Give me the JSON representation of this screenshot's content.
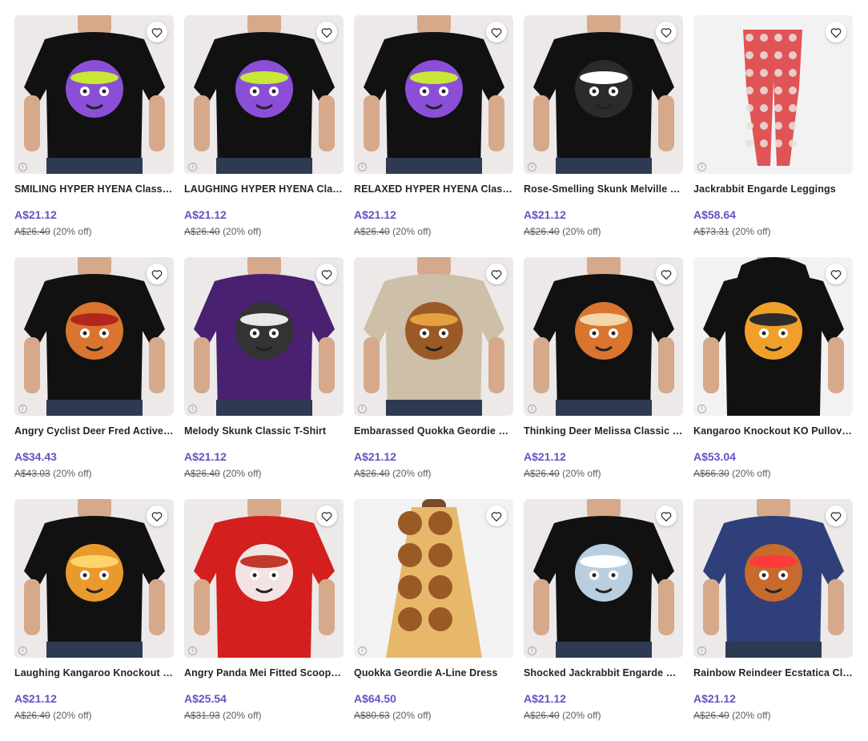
{
  "colors": {
    "price": "#6a4fc3",
    "tile_bg": "#f2f2f3"
  },
  "products": [
    {
      "title": "SMILING HYPER HYENA Classic T-Shirt",
      "price": "A$21.12",
      "original": "A$26.40",
      "discount": "(20% off)",
      "kind": "tee",
      "shirt": "#111111",
      "art": "hyena",
      "bg": "#ece9e8"
    },
    {
      "title": "LAUGHING HYPER HYENA Classic T-Shirt",
      "price": "A$21.12",
      "original": "A$26.40",
      "discount": "(20% off)",
      "kind": "tee",
      "shirt": "#111111",
      "art": "hyena2",
      "bg": "#ece9e8"
    },
    {
      "title": "RELAXED HYPER HYENA Classic T-Shirt",
      "price": "A$21.12",
      "original": "A$26.40",
      "discount": "(20% off)",
      "kind": "tee",
      "shirt": "#111111",
      "art": "hyena",
      "bg": "#ece9e8"
    },
    {
      "title": "Rose-Smelling Skunk Melville Classic T-Shirt",
      "price": "A$21.12",
      "original": "A$26.40",
      "discount": "(20% off)",
      "kind": "tee",
      "shirt": "#111111",
      "art": "skunk",
      "bg": "#ece9e8"
    },
    {
      "title": "Jackrabbit Engarde Leggings",
      "price": "A$58.64",
      "original": "A$73.31",
      "discount": "(20% off)",
      "kind": "leggings",
      "shirt": "#e05456",
      "art": "none",
      "bg": "#f2f2f3"
    },
    {
      "title": "Angry Cyclist Deer Fred Active T-Shirt",
      "price": "A$34.43",
      "original": "A$43.03",
      "discount": "(20% off)",
      "kind": "tee",
      "shirt": "#111111",
      "art": "deer",
      "bg": "#ece9e8"
    },
    {
      "title": "Melody Skunk Classic T-Shirt",
      "price": "A$21.12",
      "original": "A$26.40",
      "discount": "(20% off)",
      "kind": "tee",
      "shirt": "#4a2070",
      "art": "skunk2",
      "bg": "#ece9e8"
    },
    {
      "title": "Embarassed Quokka Geordie Classic T-Shirt",
      "price": "A$21.12",
      "original": "A$26.40",
      "discount": "(20% off)",
      "kind": "tee",
      "shirt": "#cdbfa8",
      "art": "quokka",
      "bg": "#ece9e8"
    },
    {
      "title": "Thinking Deer Melissa Classic T-Shirt",
      "price": "A$21.12",
      "original": "A$26.40",
      "discount": "(20% off)",
      "kind": "tee",
      "shirt": "#111111",
      "art": "deer2",
      "bg": "#ece9e8"
    },
    {
      "title": "Kangaroo Knockout KO Pullover Hoodie",
      "price": "A$53.04",
      "original": "A$66.30",
      "discount": "(20% off)",
      "kind": "hoodie",
      "shirt": "#111111",
      "art": "kangaroo",
      "bg": "#f2f2f3"
    },
    {
      "title": "Laughing Kangaroo Knockout Classic T-Shirt",
      "price": "A$21.12",
      "original": "A$26.40",
      "discount": "(20% off)",
      "kind": "tee",
      "shirt": "#111111",
      "art": "kangaroo2",
      "bg": "#ece9e8"
    },
    {
      "title": "Angry Panda Mei Fitted Scoop T-Shirt",
      "price": "A$25.54",
      "original": "A$31.93",
      "discount": "(20% off)",
      "kind": "scoop",
      "shirt": "#d41f1f",
      "art": "panda",
      "bg": "#ece9e8"
    },
    {
      "title": "Quokka Geordie A-Line Dress",
      "price": "A$64.50",
      "original": "A$80.63",
      "discount": "(20% off)",
      "kind": "dress",
      "shirt": "#e7b86a",
      "art": "none",
      "bg": "#f2f2f3"
    },
    {
      "title": "Shocked Jackrabbit Engarde Classic T-Shirt",
      "price": "A$21.12",
      "original": "A$26.40",
      "discount": "(20% off)",
      "kind": "tee",
      "shirt": "#111111",
      "art": "rabbit",
      "bg": "#ece9e8"
    },
    {
      "title": "Rainbow Reindeer Ecstatica Classic T-Shirt",
      "price": "A$21.12",
      "original": "A$26.40",
      "discount": "(20% off)",
      "kind": "tee",
      "shirt": "#2f3f7a",
      "art": "reindeer",
      "bg": "#ece9e8"
    }
  ],
  "icons": {
    "favorite": "heart-outline-icon",
    "info": "info-icon"
  }
}
